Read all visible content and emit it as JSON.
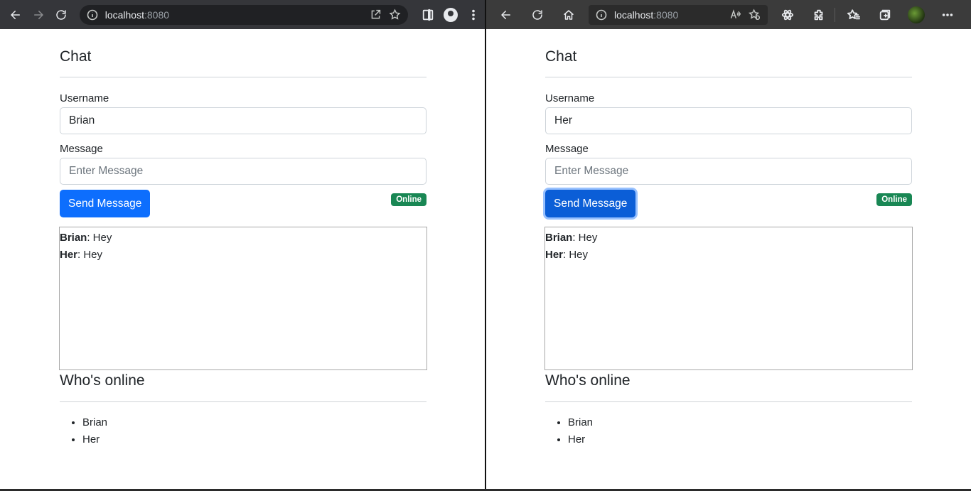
{
  "left_browser": {
    "address": {
      "host": "localhost",
      "port": ":8080"
    },
    "page": {
      "title": "Chat",
      "username_label": "Username",
      "username_value": "Brian",
      "message_label": "Message",
      "message_placeholder": "Enter Message",
      "send_button": "Send Message",
      "status_badge": "Online",
      "messages": [
        {
          "user": "Brian",
          "text": ": Hey"
        },
        {
          "user": "Her",
          "text": ": Hey"
        }
      ],
      "online_title": "Who's online",
      "online_users": [
        "Brian",
        "Her"
      ]
    }
  },
  "right_browser": {
    "address": {
      "host": "localhost",
      "port": ":8080"
    },
    "page": {
      "title": "Chat",
      "username_label": "Username",
      "username_value": "Her",
      "message_label": "Message",
      "message_placeholder": "Enter Message",
      "send_button": "Send Message",
      "status_badge": "Online",
      "messages": [
        {
          "user": "Brian",
          "text": ": Hey"
        },
        {
          "user": "Her",
          "text": ": Hey"
        }
      ],
      "online_title": "Who's online",
      "online_users": [
        "Brian",
        "Her"
      ]
    }
  },
  "colors": {
    "primary": "#0d6efd",
    "success": "#198754",
    "chrome_toolbar": "#35363a",
    "edge_toolbar": "#3b3b3b"
  }
}
